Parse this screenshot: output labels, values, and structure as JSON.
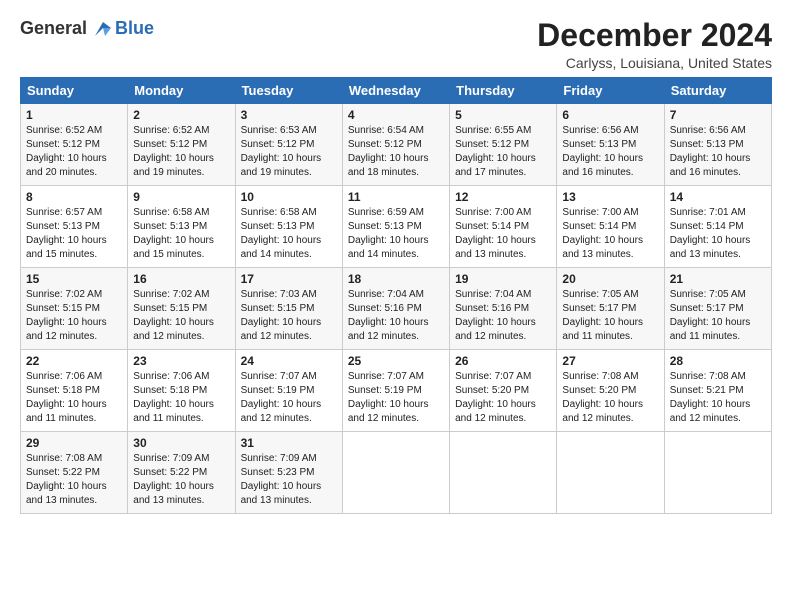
{
  "logo": {
    "general": "General",
    "blue": "Blue"
  },
  "title": "December 2024",
  "subtitle": "Carlyss, Louisiana, United States",
  "headers": [
    "Sunday",
    "Monday",
    "Tuesday",
    "Wednesday",
    "Thursday",
    "Friday",
    "Saturday"
  ],
  "weeks": [
    [
      {
        "day": "1",
        "text": "Sunrise: 6:52 AM\nSunset: 5:12 PM\nDaylight: 10 hours\nand 20 minutes."
      },
      {
        "day": "2",
        "text": "Sunrise: 6:52 AM\nSunset: 5:12 PM\nDaylight: 10 hours\nand 19 minutes."
      },
      {
        "day": "3",
        "text": "Sunrise: 6:53 AM\nSunset: 5:12 PM\nDaylight: 10 hours\nand 19 minutes."
      },
      {
        "day": "4",
        "text": "Sunrise: 6:54 AM\nSunset: 5:12 PM\nDaylight: 10 hours\nand 18 minutes."
      },
      {
        "day": "5",
        "text": "Sunrise: 6:55 AM\nSunset: 5:12 PM\nDaylight: 10 hours\nand 17 minutes."
      },
      {
        "day": "6",
        "text": "Sunrise: 6:56 AM\nSunset: 5:13 PM\nDaylight: 10 hours\nand 16 minutes."
      },
      {
        "day": "7",
        "text": "Sunrise: 6:56 AM\nSunset: 5:13 PM\nDaylight: 10 hours\nand 16 minutes."
      }
    ],
    [
      {
        "day": "8",
        "text": "Sunrise: 6:57 AM\nSunset: 5:13 PM\nDaylight: 10 hours\nand 15 minutes."
      },
      {
        "day": "9",
        "text": "Sunrise: 6:58 AM\nSunset: 5:13 PM\nDaylight: 10 hours\nand 15 minutes."
      },
      {
        "day": "10",
        "text": "Sunrise: 6:58 AM\nSunset: 5:13 PM\nDaylight: 10 hours\nand 14 minutes."
      },
      {
        "day": "11",
        "text": "Sunrise: 6:59 AM\nSunset: 5:13 PM\nDaylight: 10 hours\nand 14 minutes."
      },
      {
        "day": "12",
        "text": "Sunrise: 7:00 AM\nSunset: 5:14 PM\nDaylight: 10 hours\nand 13 minutes."
      },
      {
        "day": "13",
        "text": "Sunrise: 7:00 AM\nSunset: 5:14 PM\nDaylight: 10 hours\nand 13 minutes."
      },
      {
        "day": "14",
        "text": "Sunrise: 7:01 AM\nSunset: 5:14 PM\nDaylight: 10 hours\nand 13 minutes."
      }
    ],
    [
      {
        "day": "15",
        "text": "Sunrise: 7:02 AM\nSunset: 5:15 PM\nDaylight: 10 hours\nand 12 minutes."
      },
      {
        "day": "16",
        "text": "Sunrise: 7:02 AM\nSunset: 5:15 PM\nDaylight: 10 hours\nand 12 minutes."
      },
      {
        "day": "17",
        "text": "Sunrise: 7:03 AM\nSunset: 5:15 PM\nDaylight: 10 hours\nand 12 minutes."
      },
      {
        "day": "18",
        "text": "Sunrise: 7:04 AM\nSunset: 5:16 PM\nDaylight: 10 hours\nand 12 minutes."
      },
      {
        "day": "19",
        "text": "Sunrise: 7:04 AM\nSunset: 5:16 PM\nDaylight: 10 hours\nand 12 minutes."
      },
      {
        "day": "20",
        "text": "Sunrise: 7:05 AM\nSunset: 5:17 PM\nDaylight: 10 hours\nand 11 minutes."
      },
      {
        "day": "21",
        "text": "Sunrise: 7:05 AM\nSunset: 5:17 PM\nDaylight: 10 hours\nand 11 minutes."
      }
    ],
    [
      {
        "day": "22",
        "text": "Sunrise: 7:06 AM\nSunset: 5:18 PM\nDaylight: 10 hours\nand 11 minutes."
      },
      {
        "day": "23",
        "text": "Sunrise: 7:06 AM\nSunset: 5:18 PM\nDaylight: 10 hours\nand 11 minutes."
      },
      {
        "day": "24",
        "text": "Sunrise: 7:07 AM\nSunset: 5:19 PM\nDaylight: 10 hours\nand 12 minutes."
      },
      {
        "day": "25",
        "text": "Sunrise: 7:07 AM\nSunset: 5:19 PM\nDaylight: 10 hours\nand 12 minutes."
      },
      {
        "day": "26",
        "text": "Sunrise: 7:07 AM\nSunset: 5:20 PM\nDaylight: 10 hours\nand 12 minutes."
      },
      {
        "day": "27",
        "text": "Sunrise: 7:08 AM\nSunset: 5:20 PM\nDaylight: 10 hours\nand 12 minutes."
      },
      {
        "day": "28",
        "text": "Sunrise: 7:08 AM\nSunset: 5:21 PM\nDaylight: 10 hours\nand 12 minutes."
      }
    ],
    [
      {
        "day": "29",
        "text": "Sunrise: 7:08 AM\nSunset: 5:22 PM\nDaylight: 10 hours\nand 13 minutes."
      },
      {
        "day": "30",
        "text": "Sunrise: 7:09 AM\nSunset: 5:22 PM\nDaylight: 10 hours\nand 13 minutes."
      },
      {
        "day": "31",
        "text": "Sunrise: 7:09 AM\nSunset: 5:23 PM\nDaylight: 10 hours\nand 13 minutes."
      },
      {
        "day": "",
        "text": ""
      },
      {
        "day": "",
        "text": ""
      },
      {
        "day": "",
        "text": ""
      },
      {
        "day": "",
        "text": ""
      }
    ]
  ]
}
